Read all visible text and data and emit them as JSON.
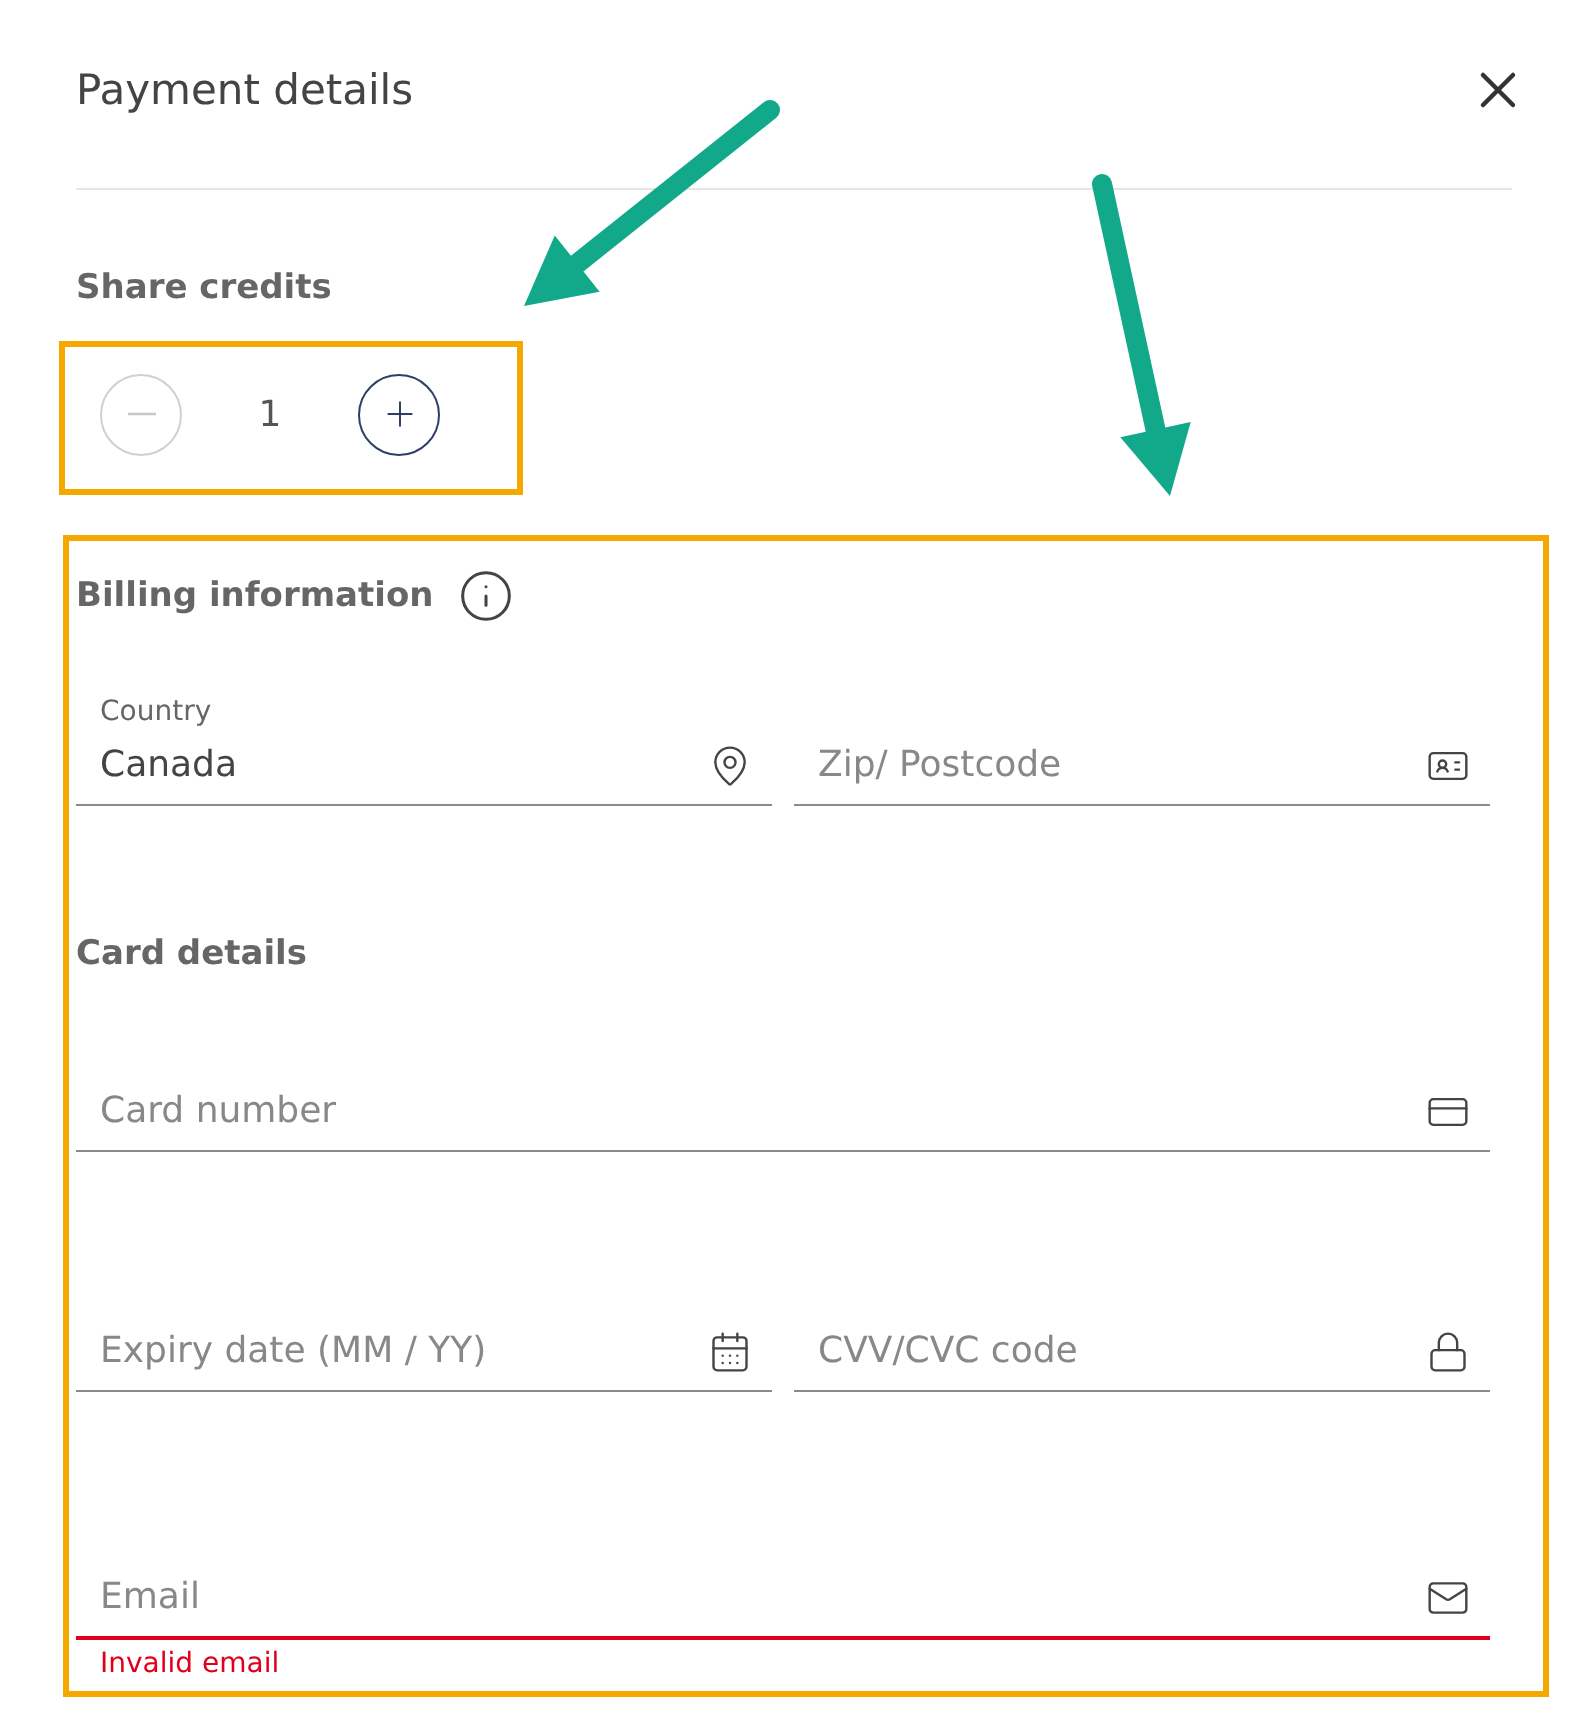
{
  "dialog": {
    "title": "Payment details"
  },
  "share_credits": {
    "label": "Share credits",
    "value": "1",
    "decrement": {
      "disabled": true
    },
    "increment": {
      "disabled": false
    }
  },
  "billing": {
    "heading": "Billing information",
    "fields": [
      {
        "label": "Country",
        "value": "Canada",
        "invalid": false
      },
      {
        "placeholder": "Zip/ Postcode",
        "invalid": false
      }
    ]
  },
  "card": {
    "heading": "Card details",
    "fields": [
      {
        "placeholder": "Card number",
        "invalid": false
      },
      {
        "placeholder": "Expiry date (MM / YY)",
        "invalid": false
      },
      {
        "placeholder": "CVV/CVC code",
        "invalid": false
      },
      {
        "placeholder": "Email",
        "invalid": true,
        "error": "Invalid email"
      }
    ]
  },
  "callouts": [
    {
      "kind": "arrow"
    },
    {
      "kind": "arrow"
    },
    {
      "kind": "frame"
    },
    {
      "kind": "frame"
    }
  ]
}
